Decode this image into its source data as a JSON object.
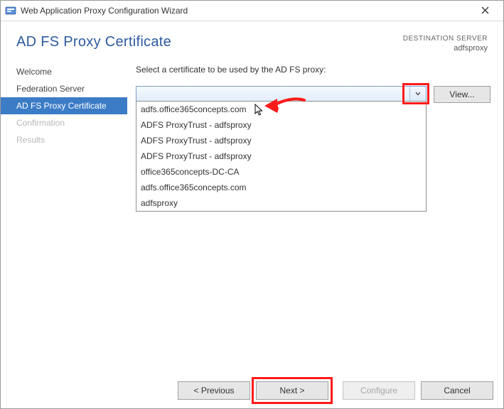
{
  "window": {
    "title": "Web Application Proxy Configuration Wizard"
  },
  "header": {
    "page_title": "AD FS Proxy Certificate",
    "destination_label": "DESTINATION SERVER",
    "destination_value": "adfsproxy"
  },
  "sidebar": {
    "steps": [
      {
        "label": "Welcome",
        "state": "normal"
      },
      {
        "label": "Federation Server",
        "state": "normal"
      },
      {
        "label": "AD FS Proxy Certificate",
        "state": "active"
      },
      {
        "label": "Confirmation",
        "state": "disabled"
      },
      {
        "label": "Results",
        "state": "disabled"
      }
    ]
  },
  "content": {
    "instruction": "Select a certificate to be used by the AD FS proxy:",
    "combo_selected": "",
    "view_button": "View...",
    "dropdown_options": [
      "adfs.office365concepts.com",
      "ADFS ProxyTrust - adfsproxy",
      "ADFS ProxyTrust - adfsproxy",
      "ADFS ProxyTrust - adfsproxy",
      "office365concepts-DC-CA",
      "adfs.office365concepts.com",
      "adfsproxy"
    ]
  },
  "footer": {
    "previous": "< Previous",
    "next": "Next >",
    "configure": "Configure",
    "cancel": "Cancel"
  }
}
